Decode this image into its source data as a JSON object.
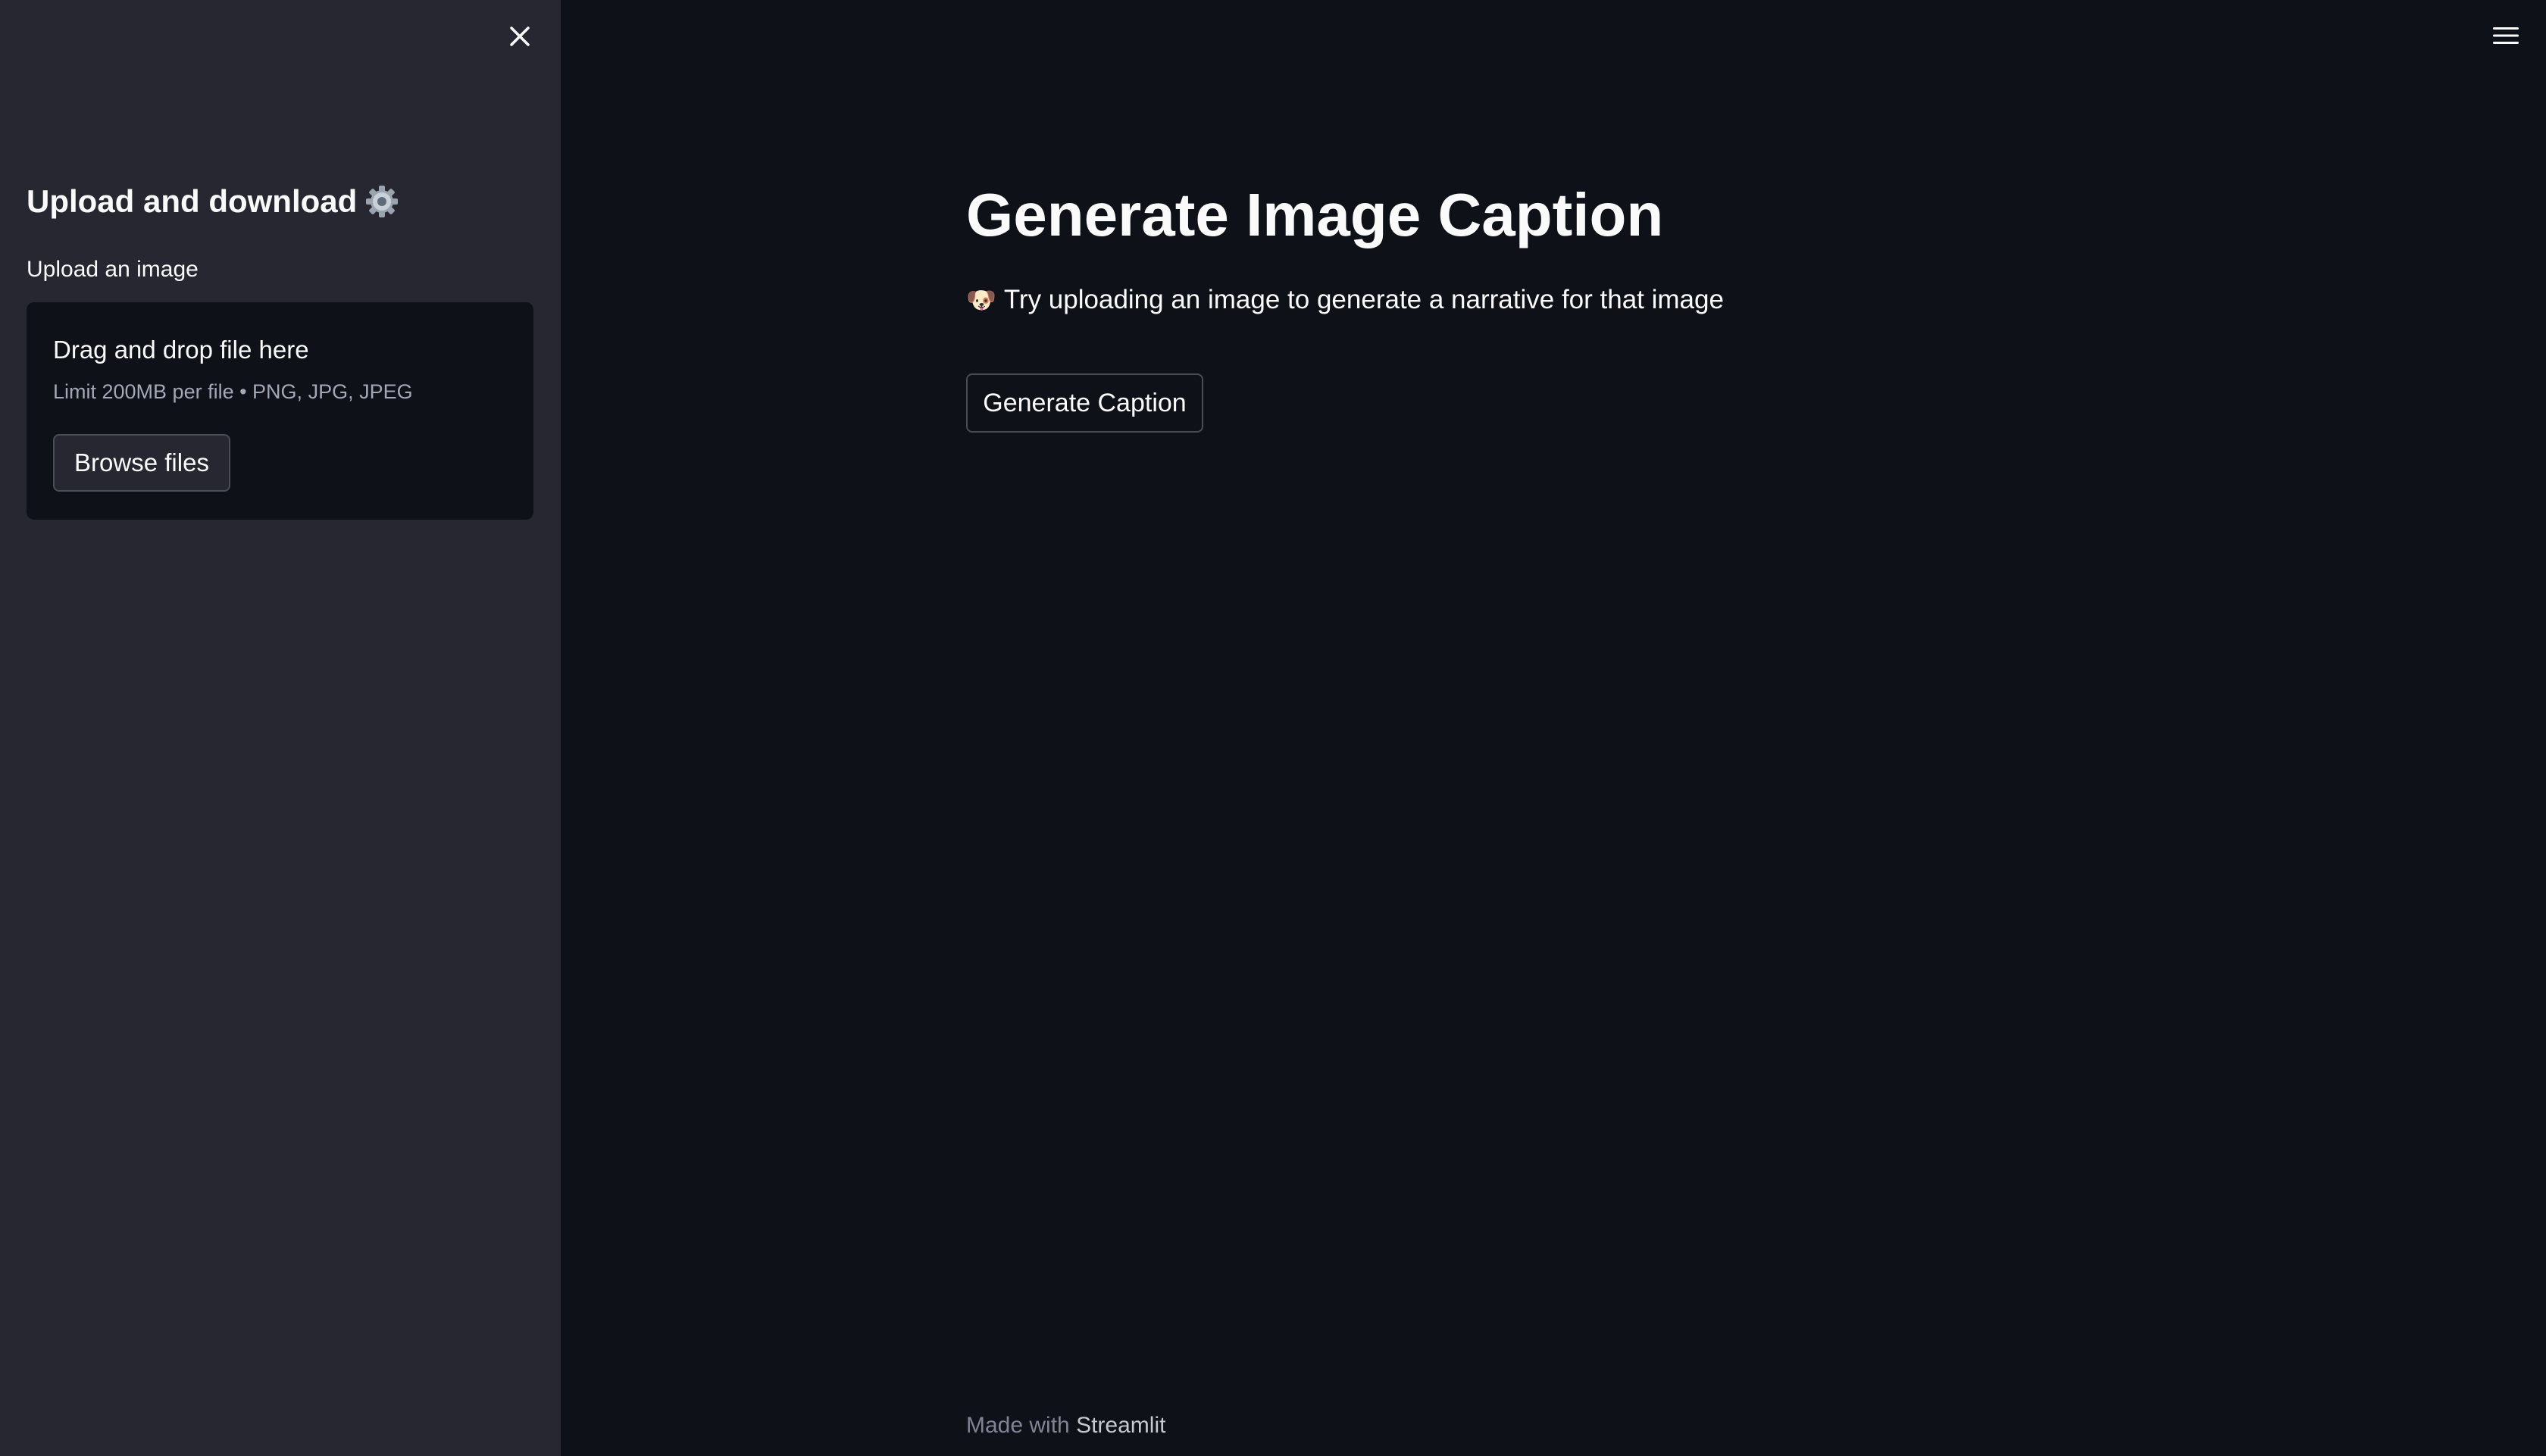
{
  "sidebar": {
    "title": "Upload and download",
    "title_icon": "gear-icon",
    "close_icon": "close-icon",
    "uploader": {
      "label": "Upload an image",
      "drop_text": "Drag and drop file here",
      "limit_text": "Limit 200MB per file • PNG, JPG, JPEG",
      "browse_label": "Browse files"
    }
  },
  "header": {
    "menu_icon": "hamburger-menu-icon"
  },
  "main": {
    "title": "Generate Image Caption",
    "subtitle_emoji": "🐶",
    "subtitle": "Try uploading an image to generate a narrative for that image",
    "generate_label": "Generate Caption"
  },
  "footer": {
    "prefix": "Made with ",
    "brand": "Streamlit"
  },
  "colors": {
    "main_bg": "#0e1117",
    "sidebar_bg": "#262730",
    "text": "#fafafa",
    "muted_text": "#808495",
    "border": "#4a4c56"
  }
}
